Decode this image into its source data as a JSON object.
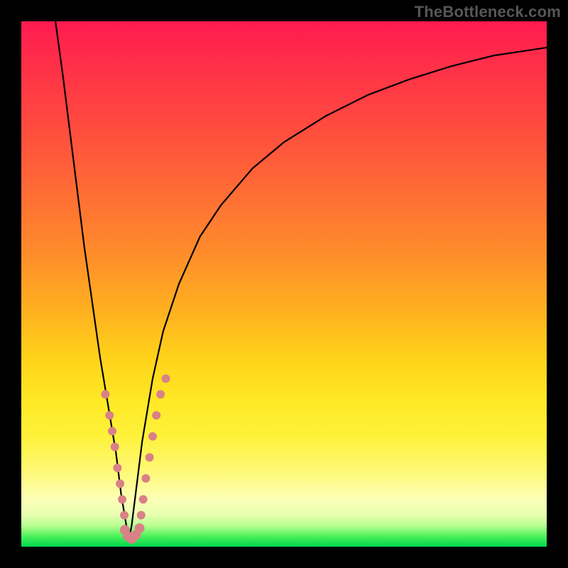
{
  "watermark": "TheBottleneck.com",
  "colors": {
    "frame": "#000000",
    "gradient_top": "#ff1a50",
    "gradient_mid": "#ffd21a",
    "gradient_bottom": "#00d84e",
    "curve": "#000000",
    "dots": "#d98186"
  },
  "chart_data": {
    "type": "line",
    "title": "",
    "xlabel": "",
    "ylabel": "",
    "xlim": [
      0,
      100
    ],
    "ylim": [
      0,
      100
    ],
    "series": [
      {
        "name": "left-branch",
        "x": [
          6.5,
          8,
          9,
          10,
          11,
          12,
          13,
          14,
          15,
          16,
          17,
          18,
          18.5,
          19,
          19.5,
          20,
          20.5
        ],
        "y": [
          100,
          89,
          81,
          73,
          65,
          57,
          50,
          43,
          36,
          30,
          24,
          18,
          14,
          10,
          7,
          4,
          1.5
        ]
      },
      {
        "name": "right-branch",
        "x": [
          20.5,
          21,
          22,
          23,
          24,
          25,
          27,
          30,
          34,
          38,
          44,
          50,
          58,
          66,
          74,
          82,
          90,
          100
        ],
        "y": [
          1.5,
          4,
          12,
          20,
          26,
          32,
          41,
          50,
          59,
          65,
          72,
          77,
          82,
          86,
          89,
          91.5,
          93.5,
          95
        ]
      }
    ],
    "scatter": {
      "name": "dots",
      "points": [
        {
          "x": 16.0,
          "y": 29,
          "r": 6
        },
        {
          "x": 16.8,
          "y": 25,
          "r": 6
        },
        {
          "x": 17.3,
          "y": 22,
          "r": 6
        },
        {
          "x": 17.8,
          "y": 19,
          "r": 6
        },
        {
          "x": 18.3,
          "y": 15,
          "r": 6
        },
        {
          "x": 18.8,
          "y": 12,
          "r": 6
        },
        {
          "x": 19.2,
          "y": 9,
          "r": 6
        },
        {
          "x": 19.6,
          "y": 6,
          "r": 6
        },
        {
          "x": 19.7,
          "y": 3.2,
          "r": 7
        },
        {
          "x": 20.3,
          "y": 2.0,
          "r": 7
        },
        {
          "x": 21.0,
          "y": 1.5,
          "r": 7
        },
        {
          "x": 21.8,
          "y": 2.2,
          "r": 7
        },
        {
          "x": 22.5,
          "y": 3.5,
          "r": 7
        },
        {
          "x": 22.8,
          "y": 6,
          "r": 6
        },
        {
          "x": 23.2,
          "y": 9,
          "r": 6
        },
        {
          "x": 23.7,
          "y": 13,
          "r": 6
        },
        {
          "x": 24.4,
          "y": 17,
          "r": 6
        },
        {
          "x": 25.0,
          "y": 21,
          "r": 6
        },
        {
          "x": 25.7,
          "y": 25,
          "r": 6
        },
        {
          "x": 26.5,
          "y": 29,
          "r": 6
        },
        {
          "x": 27.5,
          "y": 32,
          "r": 6
        }
      ]
    }
  }
}
